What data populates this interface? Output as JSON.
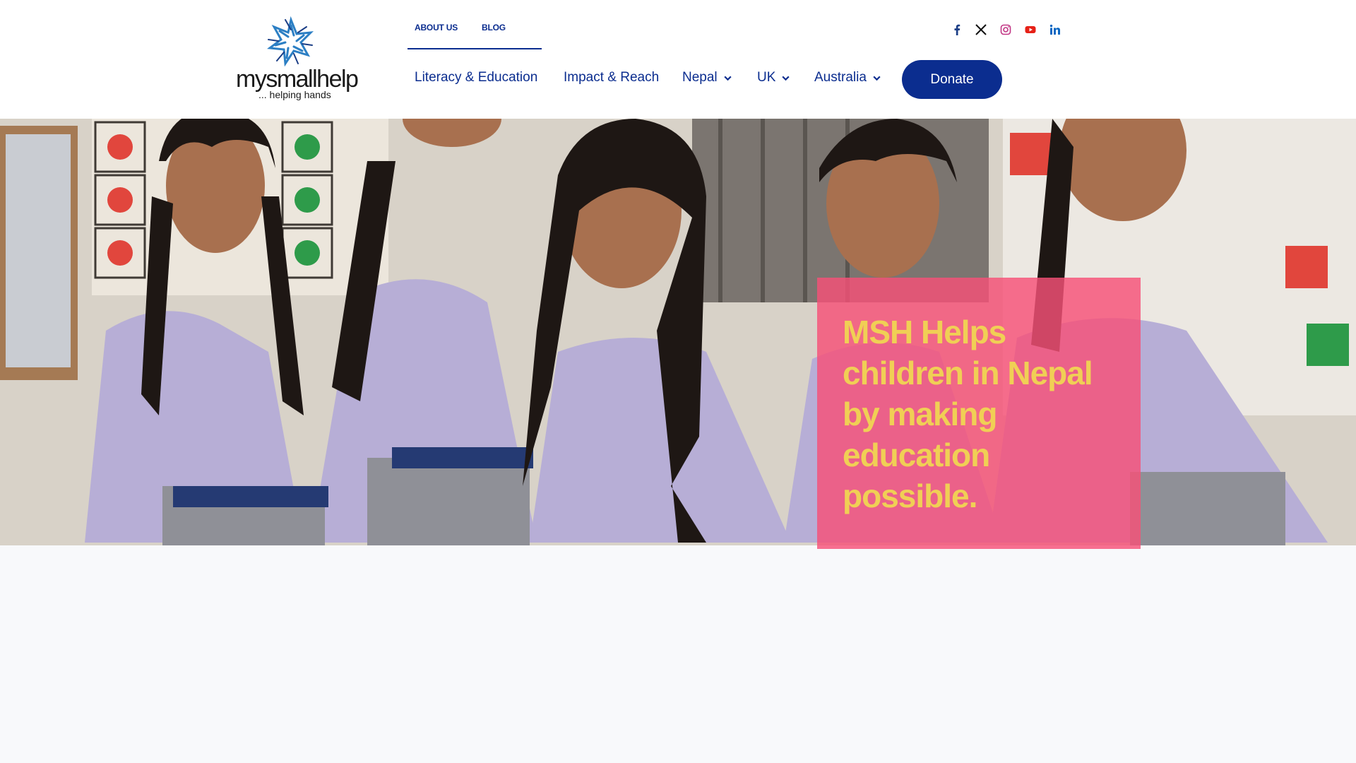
{
  "brand": {
    "name": "mysmallhelp",
    "tagline": "... helping hands"
  },
  "top_nav": {
    "items": [
      {
        "label": "ABOUT US"
      },
      {
        "label": "BLOG"
      }
    ]
  },
  "social": {
    "items": [
      {
        "icon": "facebook-icon",
        "color": "#1877f2"
      },
      {
        "icon": "x-twitter-icon",
        "color": "#000000"
      },
      {
        "icon": "instagram-icon",
        "color": "#c13584"
      },
      {
        "icon": "youtube-icon",
        "color": "#e62117"
      },
      {
        "icon": "linkedin-icon",
        "color": "#0a66c2"
      }
    ]
  },
  "main_nav": {
    "items": [
      {
        "label": "Literacy & Education",
        "has_dropdown": false
      },
      {
        "label": "Impact & Reach",
        "has_dropdown": false
      },
      {
        "label": "Nepal",
        "has_dropdown": true
      },
      {
        "label": "UK",
        "has_dropdown": true
      },
      {
        "label": "Australia",
        "has_dropdown": true
      }
    ],
    "donate_label": "Donate"
  },
  "hero": {
    "headline": "MSH Helps children in Nepal by making education possible."
  },
  "colors": {
    "primary": "#0b2d8f",
    "callout_bg": "#f65078",
    "callout_text": "#f0cf55",
    "page_bg": "#f8f9fb"
  }
}
